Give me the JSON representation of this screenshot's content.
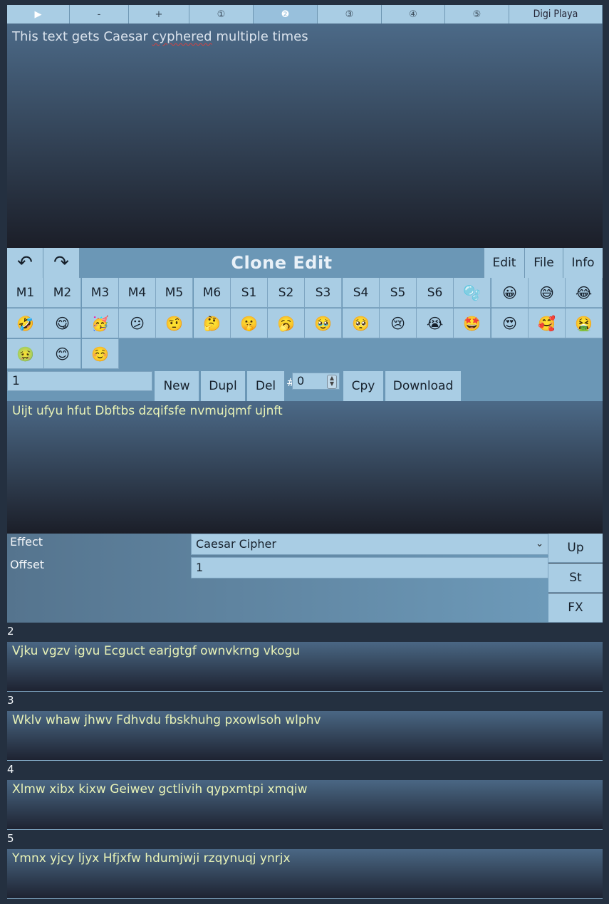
{
  "tabs": [
    {
      "label": "▶",
      "name": "tab-play"
    },
    {
      "label": "-",
      "name": "tab-minus"
    },
    {
      "label": "+",
      "name": "tab-plus"
    },
    {
      "label": "①",
      "name": "tab-1"
    },
    {
      "label": "❷",
      "name": "tab-2"
    },
    {
      "label": "③",
      "name": "tab-3"
    },
    {
      "label": "④",
      "name": "tab-4"
    },
    {
      "label": "⑤",
      "name": "tab-5"
    },
    {
      "label": "Digi Playa",
      "name": "tab-digi-playa"
    }
  ],
  "main_text": {
    "before": "This text gets Caesar ",
    "misspelled": "cyphered",
    "after": " multiple times"
  },
  "clone_bar": {
    "undo_icon": "↶",
    "redo_icon": "↷",
    "title": "Clone Edit",
    "edit_label": "Edit",
    "file_label": "File",
    "info_label": "Info"
  },
  "grid_row1": [
    "M1",
    "M2",
    "M3",
    "M4",
    "M5",
    "M6",
    "S1",
    "S2",
    "S3",
    "S4",
    "S5",
    "S6"
  ],
  "emoji_row1": [
    "🫧",
    "😀",
    "😅",
    "😂"
  ],
  "emoji_row2": [
    "🤣",
    "😋",
    "🥳",
    "😕",
    "🤨",
    "🤔",
    "🤫",
    "🥱",
    "🥹",
    "🥺",
    "😢",
    "😭",
    "🤩",
    "😍",
    "🥰",
    "🤮"
  ],
  "emoji_row3": [
    "🤢",
    "😊",
    "☺️"
  ],
  "controls": {
    "name_value": "1",
    "new_label": "New",
    "dupl_label": "Dupl",
    "del_label": "Del",
    "hash": "#",
    "number_value": "0",
    "cpy_label": "Cpy",
    "download_label": "Download"
  },
  "output_text": "Uijt ufyu hfut Dbftbs dzqifsfe nvmujqmf ujnft",
  "effect": {
    "effect_label": "Effect",
    "effect_value": "Caesar Cipher",
    "offset_label": "Offset",
    "offset_value": "1",
    "up_label": "Up",
    "st_label": "St",
    "fx_label": "FX"
  },
  "clones": [
    {
      "num": "2",
      "text": "Vjku vgzv igvu Ecguct earjgtgf ownvkrng vkogu"
    },
    {
      "num": "3",
      "text": "Wklv whaw jhwv Fdhvdu fbskhuhg pxowlsoh wlphv"
    },
    {
      "num": "4",
      "text": "Xlmw xibx kixw Geiwev gctlivih qypxmtpi xmqiw"
    },
    {
      "num": "5",
      "text": "Ymnx yjcy ljyx Hfjxfw hdumjwji rzqynuqj ynrjx"
    }
  ],
  "colors": {
    "button_bg": "#a9cde4",
    "panel_bg": "#6b97b6",
    "output_text": "#e8f2b6"
  }
}
